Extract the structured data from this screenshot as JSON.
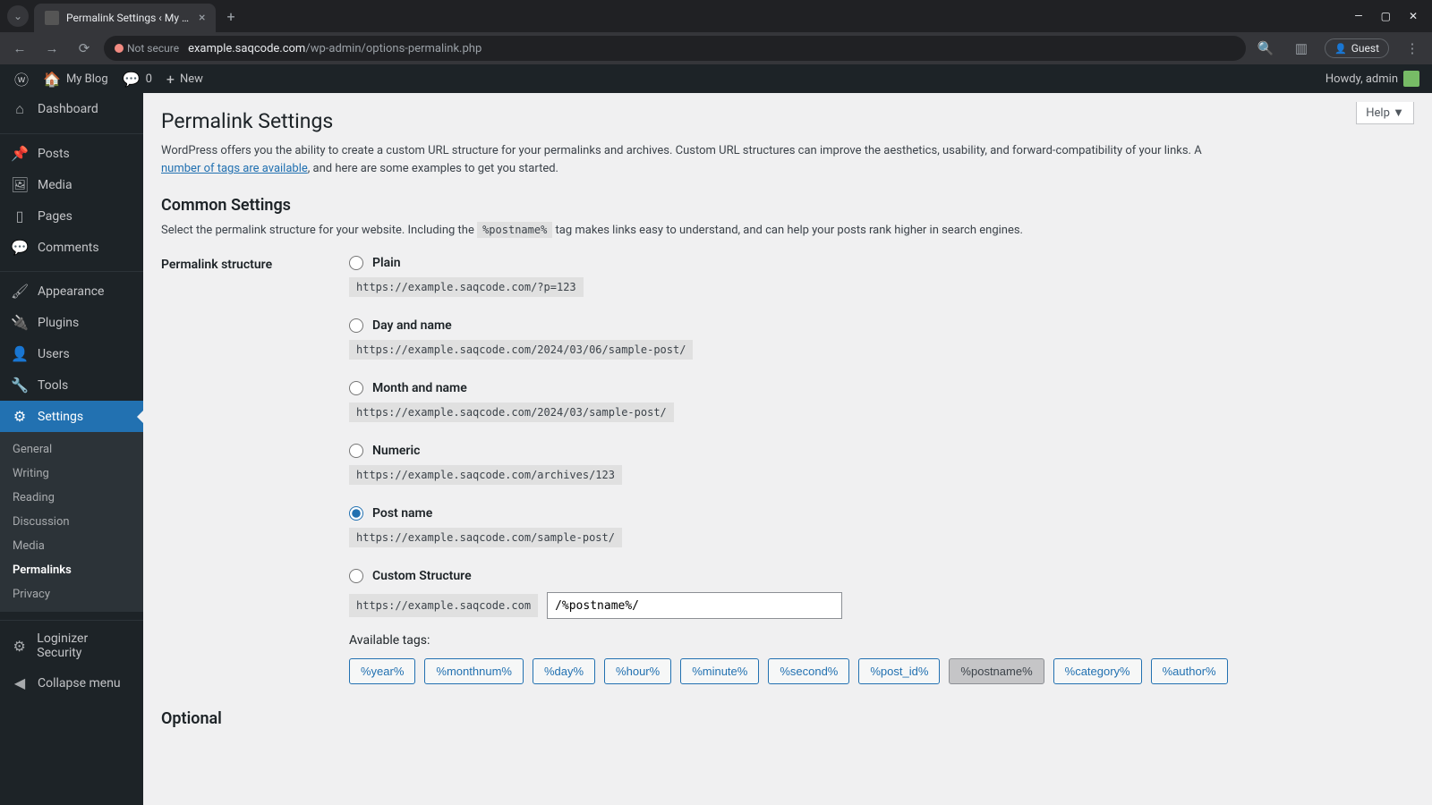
{
  "browser": {
    "tab_title": "Permalink Settings ‹ My Blog —",
    "url_prefix": "example.saqcode.com",
    "url_path": "/wp-admin/options-permalink.php",
    "not_secure": "Not secure",
    "guest": "Guest"
  },
  "adminbar": {
    "site_name": "My Blog",
    "comments_count": "0",
    "new_label": "New",
    "howdy": "Howdy, admin"
  },
  "sidebar": {
    "items": [
      {
        "icon": "⌂",
        "label": "Dashboard"
      },
      {
        "icon": "📌",
        "label": "Posts"
      },
      {
        "icon": "🖼",
        "label": "Media"
      },
      {
        "icon": "▯",
        "label": "Pages"
      },
      {
        "icon": "💬",
        "label": "Comments"
      },
      {
        "icon": "🖌",
        "label": "Appearance"
      },
      {
        "icon": "🔌",
        "label": "Plugins"
      },
      {
        "icon": "👤",
        "label": "Users"
      },
      {
        "icon": "🔧",
        "label": "Tools"
      },
      {
        "icon": "⚙",
        "label": "Settings"
      },
      {
        "icon": "⚙",
        "label": "Loginizer Security"
      },
      {
        "icon": "◀",
        "label": "Collapse menu"
      }
    ],
    "settings_sub": [
      "General",
      "Writing",
      "Reading",
      "Discussion",
      "Media",
      "Permalinks",
      "Privacy"
    ]
  },
  "content": {
    "help": "Help ▼",
    "title": "Permalink Settings",
    "intro_a": "WordPress offers you the ability to create a custom URL structure for your permalinks and archives. Custom URL structures can improve the aesthetics, usability, and forward-compatibility of your links. A ",
    "intro_link": "number of tags are available",
    "intro_b": ", and here are some examples to get you started.",
    "common_heading": "Common Settings",
    "common_desc_a": "Select the permalink structure for your website. Including the ",
    "common_code": "%postname%",
    "common_desc_b": " tag makes links easy to understand, and can help your posts rank higher in search engines.",
    "structure_label": "Permalink structure",
    "options": [
      {
        "label": "Plain",
        "example": "https://example.saqcode.com/?p=123",
        "checked": false
      },
      {
        "label": "Day and name",
        "example": "https://example.saqcode.com/2024/03/06/sample-post/",
        "checked": false
      },
      {
        "label": "Month and name",
        "example": "https://example.saqcode.com/2024/03/sample-post/",
        "checked": false
      },
      {
        "label": "Numeric",
        "example": "https://example.saqcode.com/archives/123",
        "checked": false
      },
      {
        "label": "Post name",
        "example": "https://example.saqcode.com/sample-post/",
        "checked": true
      },
      {
        "label": "Custom Structure",
        "example": "",
        "checked": false
      }
    ],
    "custom_prefix": "https://example.saqcode.com",
    "custom_value": "/%postname%/",
    "available_tags_label": "Available tags:",
    "tags": [
      "%year%",
      "%monthnum%",
      "%day%",
      "%hour%",
      "%minute%",
      "%second%",
      "%post_id%",
      "%postname%",
      "%category%",
      "%author%"
    ],
    "active_tag": "%postname%",
    "optional_heading": "Optional"
  }
}
